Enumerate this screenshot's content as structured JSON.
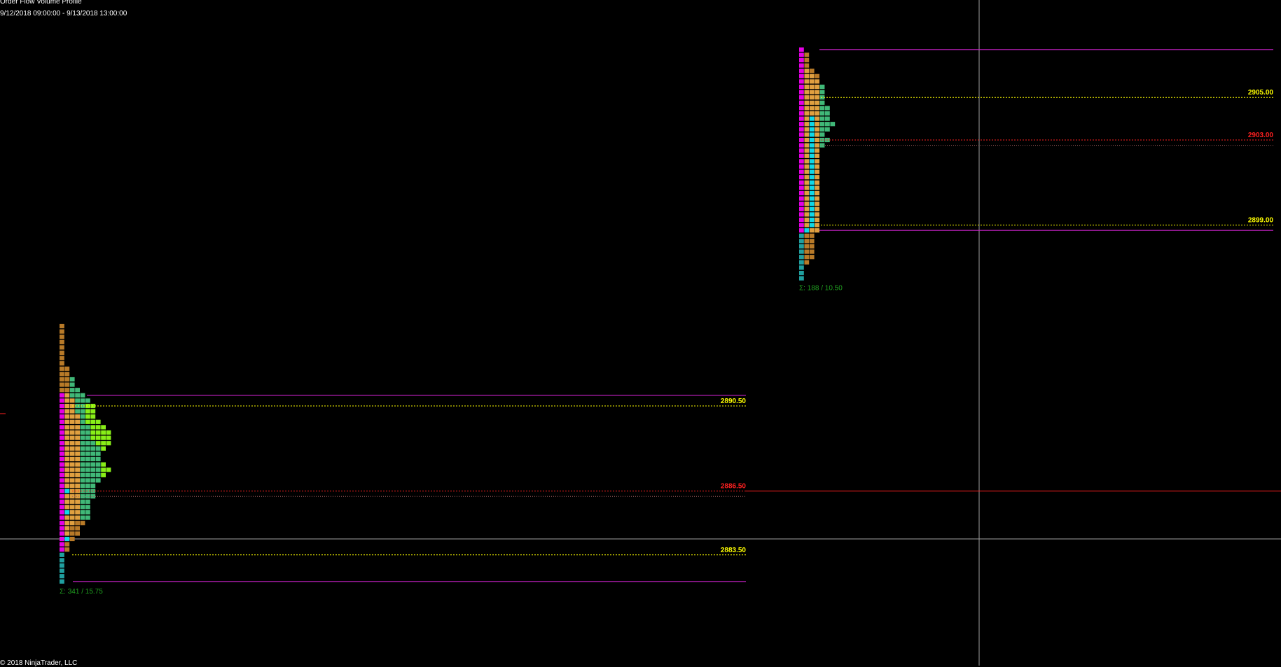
{
  "header": {
    "title": "Order Flow Volume Profile",
    "range": "9/12/2018 09:00:00 - 9/13/2018 13:00:00"
  },
  "footer": {
    "copyright": "© 2018 NinjaTrader, LLC"
  },
  "colors": {
    "background": "#000000",
    "magenta": "#e600e6",
    "orange": "#e0a040",
    "dark_orange": "#b87a28",
    "teal": "#20a0a0",
    "cyan": "#10d8e8",
    "green": "#40b878",
    "lime": "#88ee18",
    "value_area": "#ffff00",
    "poc": "#ff2020",
    "session_range": "#cc22cc",
    "crosshair": "#a0a0a0",
    "summary": "#20a020"
  },
  "chart_data": {
    "type": "volume-profile",
    "tick_size": 0.25,
    "crosshair": {
      "price": 2884.25
    },
    "profiles": [
      {
        "name": "profile-1",
        "top_price": 2894.25,
        "high_line": 2891.0,
        "vah": 2890.5,
        "vah_label": "2890.50",
        "poc": 2886.5,
        "poc_label": "2886.50",
        "poc_line_2": 2886.25,
        "val": 2883.5,
        "val_label": "2883.50",
        "low_line": 2882.25,
        "summary": "Σ: 341 / 15.75",
        "rows": [
          "D",
          "D",
          "D",
          "D",
          "D",
          "D",
          "D",
          "D",
          "DD",
          "DD",
          "DDG",
          "DDG",
          "DDGG",
          "MOGGG",
          "MOOGGG",
          "MOOGGLL",
          "MOOGGLL",
          "MOOOGLL",
          "MOOOGLLL",
          "MOOOGGLLL",
          "MOOOGGLLLL",
          "MOOOGGLLLL",
          "MOOOGGGLLL",
          "MOOOGGGGL",
          "MOOOGGGG",
          "MOOOGGGG",
          "MOOOGGGGL",
          "MOOOGGGGLL",
          "MOOOGGGGL",
          "MOOOGGGG",
          "MOOOGGG",
          "MCOOGGG",
          "MOOOGGG",
          "MOOOGG",
          "MOOOGG",
          "MCOOGG",
          "MOOOGG",
          "MOODD",
          "MODD",
          "MODD",
          "MCD",
          "MD",
          "MD",
          "T",
          "T",
          "T",
          "T",
          "T",
          "T"
        ]
      },
      {
        "name": "profile-2",
        "top_price": 2907.25,
        "high_line": 2907.25,
        "vah": 2905.0,
        "vah_label": "2905.00",
        "poc": 2903.0,
        "poc_label": "2903.00",
        "poc_line_2": 2902.75,
        "val": 2899.0,
        "val_label": "2899.00",
        "low_line": 2898.75,
        "summary": "Σ: 188 / 10.50",
        "rows": [
          "M",
          "MD",
          "MD",
          "MD",
          "MOD",
          "MOOD",
          "MOOO",
          "MOOOG",
          "MOOOG",
          "MOOOG",
          "MOOOG",
          "MOOOGG",
          "MOOOGG",
          "MOCOGG",
          "MOCOGGG",
          "MOCOGG",
          "MOCOG",
          "MOCOGG",
          "MOCOG",
          "MOCO",
          "MOCO",
          "MOCO",
          "MOCO",
          "MOCO",
          "MOCO",
          "MOCO",
          "MOCO",
          "MOCO",
          "MOCO",
          "MOCO",
          "MOCO",
          "MOCO",
          "MOCO",
          "MOCO",
          "MCOO",
          "TDD",
          "TDD",
          "TDD",
          "TDD",
          "TDD",
          "TD",
          "T",
          "T",
          "T"
        ]
      }
    ]
  }
}
